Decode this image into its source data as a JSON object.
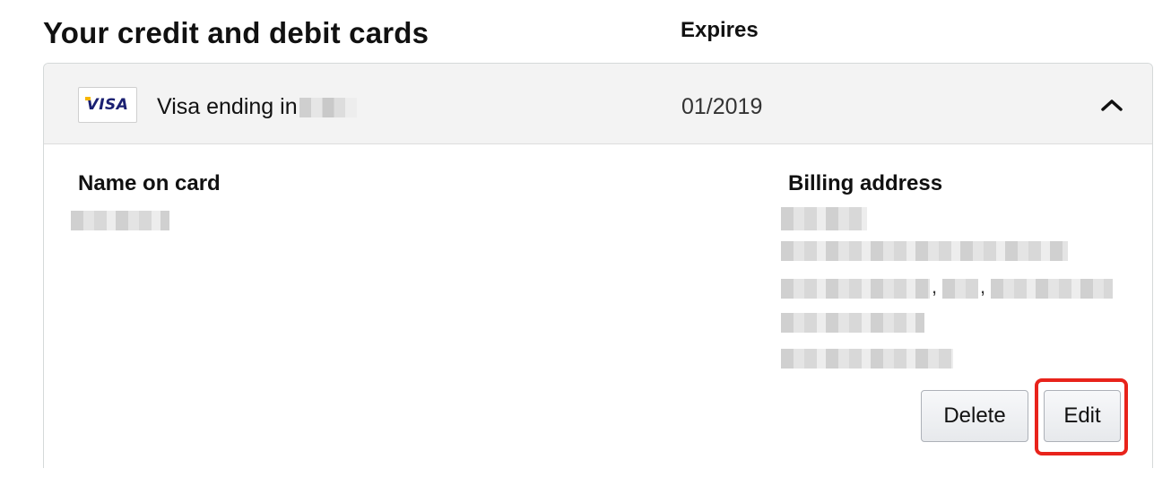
{
  "section": {
    "title": "Your credit and debit cards",
    "expires_label": "Expires"
  },
  "card": {
    "brand_logo_text": "VISA",
    "name": "Visa ending in",
    "expiry": "01/2019",
    "collapse_icon": "chevron-up-icon",
    "details": {
      "name_label": "Name on card",
      "billing_label": "Billing address"
    },
    "actions": {
      "delete_label": "Delete",
      "edit_label": "Edit"
    }
  },
  "highlight_color": "#e8231b",
  "visa_colors": {
    "blue": "#1a1f71",
    "gold": "#f7b600"
  }
}
